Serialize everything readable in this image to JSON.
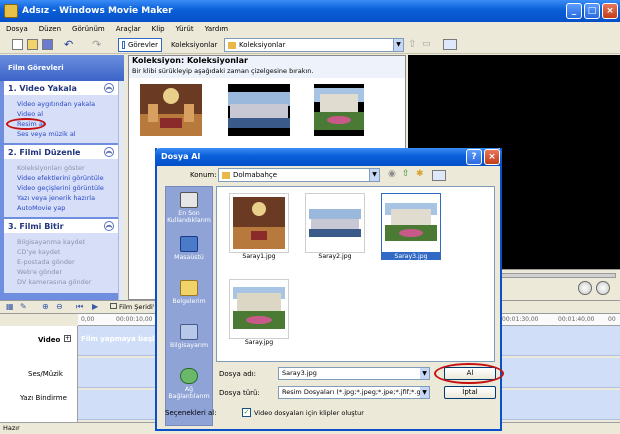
{
  "window": {
    "title": "Adsız - Windows Movie Maker"
  },
  "menu": [
    "Dosya",
    "Düzen",
    "Görünüm",
    "Araçlar",
    "Klip",
    "Yürüt",
    "Yardım"
  ],
  "toolbar": {
    "tasks_label": "Görevler",
    "collections_label": "Koleksiyonlar",
    "collection_combo": "Koleksiyonlar"
  },
  "taskpane": {
    "header": "Film Görevleri",
    "sections": [
      {
        "title": "1. Video Yakala",
        "items": [
          "Video aygıtından yakala",
          "Video al",
          "Resim al",
          "Ses veya müzik al"
        ]
      },
      {
        "title": "2. Filmi Düzenle",
        "items": [
          "Koleksiyonları göster",
          "Video efektlerini görüntüle",
          "Video geçişlerini görüntüle",
          "Yazı veya jenerik hazırla",
          "AutoMovie yap"
        ]
      },
      {
        "title": "3. Filmi Bitir",
        "items": [
          "Bilgisayarıma kaydet",
          "CD'ye kaydet",
          "E-postada gönder",
          "Web'e gönder",
          "DV kamerasına gönder"
        ]
      }
    ]
  },
  "collections": {
    "title": "Koleksiyon: Koleksiyonlar",
    "subtitle": "Bir klibi sürükleyip aşağıdaki zaman çizelgesine bırakın."
  },
  "storyboard": {
    "toggle_label": "Film Şeridi'ni",
    "time_ticks": [
      "0,00",
      "00:00:10,00",
      "00:01:30,00",
      "00:01:40,00",
      "00"
    ],
    "tracks": [
      "Video",
      "Ses/Müzik",
      "Yazı Bindirme"
    ],
    "video_placeholder": "Film yapmaya başlam"
  },
  "status": "Hazır",
  "dialog": {
    "title": "Dosya Al",
    "look_in_label": "Konum:",
    "look_in_value": "Dolmabahçe",
    "places": [
      "En Son Kullandıklarım",
      "Masaüstü",
      "Belgelerim",
      "Bilgisayarım",
      "Ağ Bağlantılarım"
    ],
    "files": [
      {
        "name": "Saray1.jpg",
        "selected": false
      },
      {
        "name": "Saray2.jpg",
        "selected": false
      },
      {
        "name": "Saray3.jpg",
        "selected": true
      },
      {
        "name": "Saray.jpg",
        "selected": false
      }
    ],
    "filename_label": "Dosya adı:",
    "filename_value": "Saray3.jpg",
    "filetype_label": "Dosya türü:",
    "filetype_value": "Resim Dosyaları (*.jpg;*.jpeg;*.jpe;*.jfif;*.gif;*.png",
    "import_button": "Al",
    "cancel_button": "İptal",
    "options_label": "Seçenekleri al:",
    "option_checkbox_label": "Video dosyaları için klipler oluştur",
    "option_checked": true
  },
  "colors": {
    "highlight_oval": "#c41010",
    "xp_blue": "#0a5fd8"
  }
}
